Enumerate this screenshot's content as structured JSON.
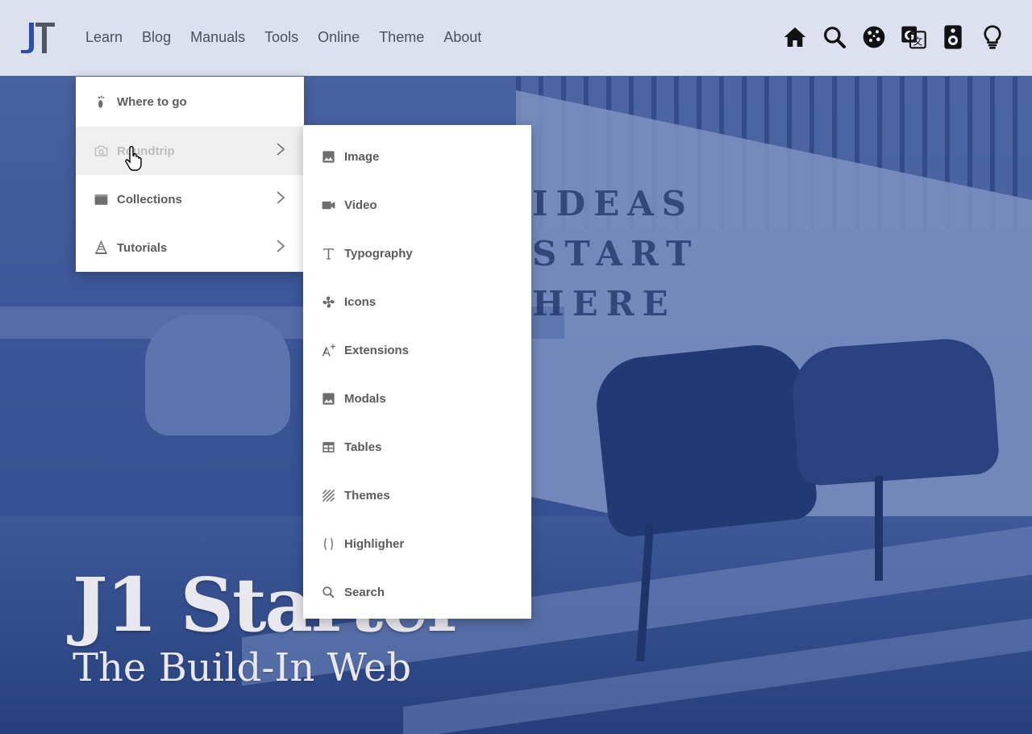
{
  "navbar": {
    "links": [
      "Learn",
      "Blog",
      "Manuals",
      "Tools",
      "Online",
      "Theme",
      "About"
    ],
    "icons": [
      "home-icon",
      "search-icon",
      "cookie-icon",
      "translate-icon",
      "speaker-icon",
      "lightbulb-icon"
    ]
  },
  "menu_learn": {
    "items": [
      {
        "label": "Where to go",
        "icon": "footprint-icon",
        "submenu": false
      },
      {
        "label": "Roundtrip",
        "icon": "image-search-icon",
        "submenu": true,
        "active": true
      },
      {
        "label": "Collections",
        "icon": "folder-icon",
        "submenu": true
      },
      {
        "label": "Tutorials",
        "icon": "school-icon",
        "submenu": true
      }
    ]
  },
  "menu_roundtrip": {
    "items": [
      {
        "label": "Image",
        "icon": "image-icon"
      },
      {
        "label": "Video",
        "icon": "video-icon"
      },
      {
        "label": "Typography",
        "icon": "text-icon"
      },
      {
        "label": "Icons",
        "icon": "fan-icon"
      },
      {
        "label": "Extensions",
        "icon": "font-plus-icon"
      },
      {
        "label": "Modals",
        "icon": "image-icon"
      },
      {
        "label": "Tables",
        "icon": "table-icon"
      },
      {
        "label": "Themes",
        "icon": "palette-icon"
      },
      {
        "label": "Highligher",
        "icon": "code-braces-icon"
      },
      {
        "label": "Search",
        "icon": "search-icon"
      }
    ]
  },
  "hero": {
    "slogan": [
      "IDEAS",
      "START",
      "HERE"
    ],
    "title": "J1 Starter",
    "subtitle": "The Build-In Web"
  }
}
